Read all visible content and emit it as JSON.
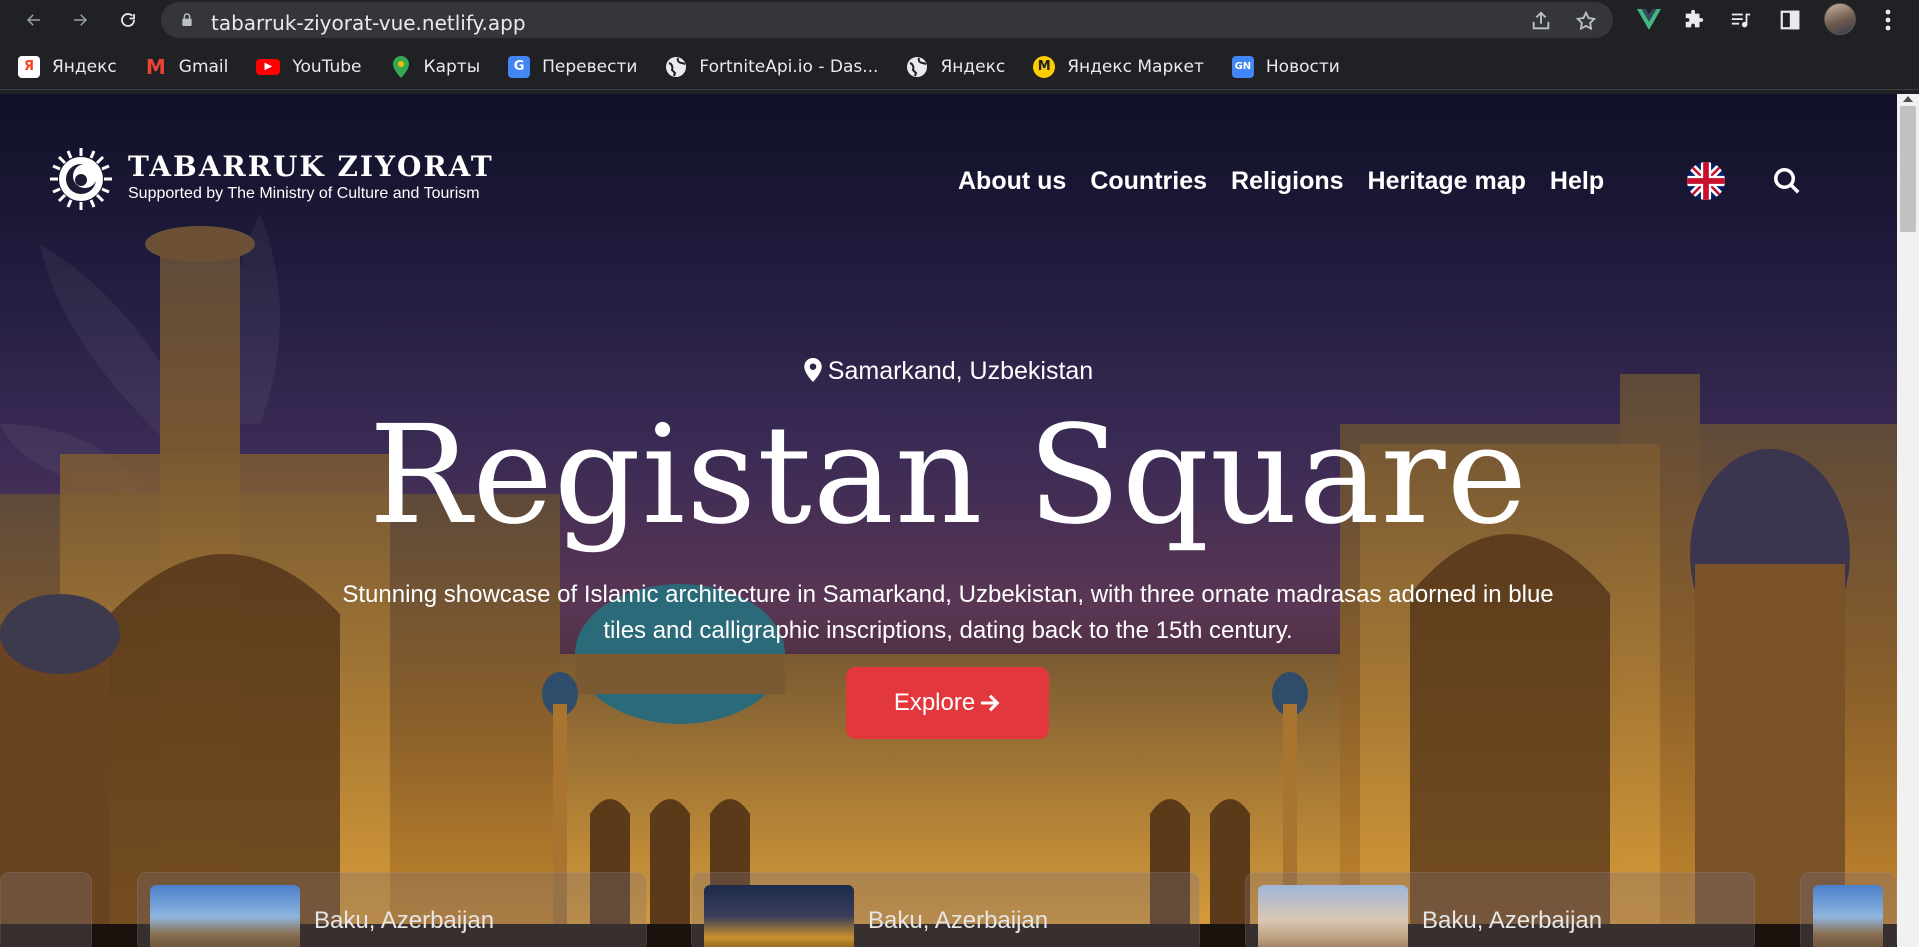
{
  "browser": {
    "url": "tabarruk-ziyorat-vue.netlify.app",
    "bookmarks": [
      {
        "label": "Яндекс",
        "icon": "yandex-icon",
        "color": "#fc3f1d"
      },
      {
        "label": "Gmail",
        "icon": "gmail-icon",
        "color": "#ea4335"
      },
      {
        "label": "YouTube",
        "icon": "youtube-icon",
        "color": "#ff0000"
      },
      {
        "label": "Карты",
        "icon": "maps-icon",
        "color": "#34a853"
      },
      {
        "label": "Перевести",
        "icon": "translate-icon",
        "color": "#4285f4"
      },
      {
        "label": "FortniteApi.io - Das...",
        "icon": "globe-icon",
        "color": "#5f6368"
      },
      {
        "label": "Яндекс",
        "icon": "globe-icon",
        "color": "#5f6368"
      },
      {
        "label": "Яндекс Маркет",
        "icon": "yandex-market-icon",
        "color": "#ffcc00"
      },
      {
        "label": "Новости",
        "icon": "news-icon",
        "color": "#4285f4"
      }
    ]
  },
  "header": {
    "title": "TABARRUK ZIYORAT",
    "subtitle": "Supported by The Ministry of Culture and Tourism",
    "nav": [
      "About us",
      "Countries",
      "Religions",
      "Heritage map",
      "Help"
    ]
  },
  "hero": {
    "location": "Samarkand, Uzbekistan",
    "title": "Registan Square",
    "description": "Stunning showcase of Islamic architecture in Samarkand, Uzbekistan, with three ornate madrasas adorned in blue tiles and calligraphic inscriptions, dating back to the 15th century.",
    "cta": "Explore"
  },
  "cards": [
    {
      "label": "Baku, Azerbaijan"
    },
    {
      "label": "Baku, Azerbaijan"
    },
    {
      "label": "Baku, Azerbaijan"
    }
  ],
  "colors": {
    "accent": "#e3373e",
    "browser_bg": "#202124",
    "omnibox": "#35363a"
  }
}
